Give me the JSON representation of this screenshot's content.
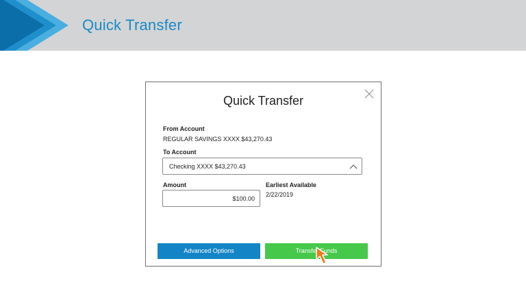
{
  "header": {
    "title": "Quick Transfer"
  },
  "modal": {
    "title": "Quick Transfer",
    "close_icon": "close-icon",
    "from_account": {
      "label": "From Account",
      "value": "REGULAR SAVINGS XXXX $43,270.43"
    },
    "to_account": {
      "label": "To Account",
      "selected": "Checking XXXX $43,270.43",
      "icon": "chevron-up-icon"
    },
    "amount": {
      "label": "Amount",
      "value": "$100.00"
    },
    "earliest_available": {
      "label": "Earliest Available",
      "value": "2/22/2019"
    },
    "buttons": {
      "advanced_options": "Advanced Options",
      "transfer_funds": "Transfer Funds"
    }
  },
  "colors": {
    "header_bg": "#d3d4d6",
    "title_blue": "#1a8ac4",
    "primary_blue": "#1385c6",
    "success_green": "#46c84a",
    "cursor_orange": "#f07a1a"
  }
}
